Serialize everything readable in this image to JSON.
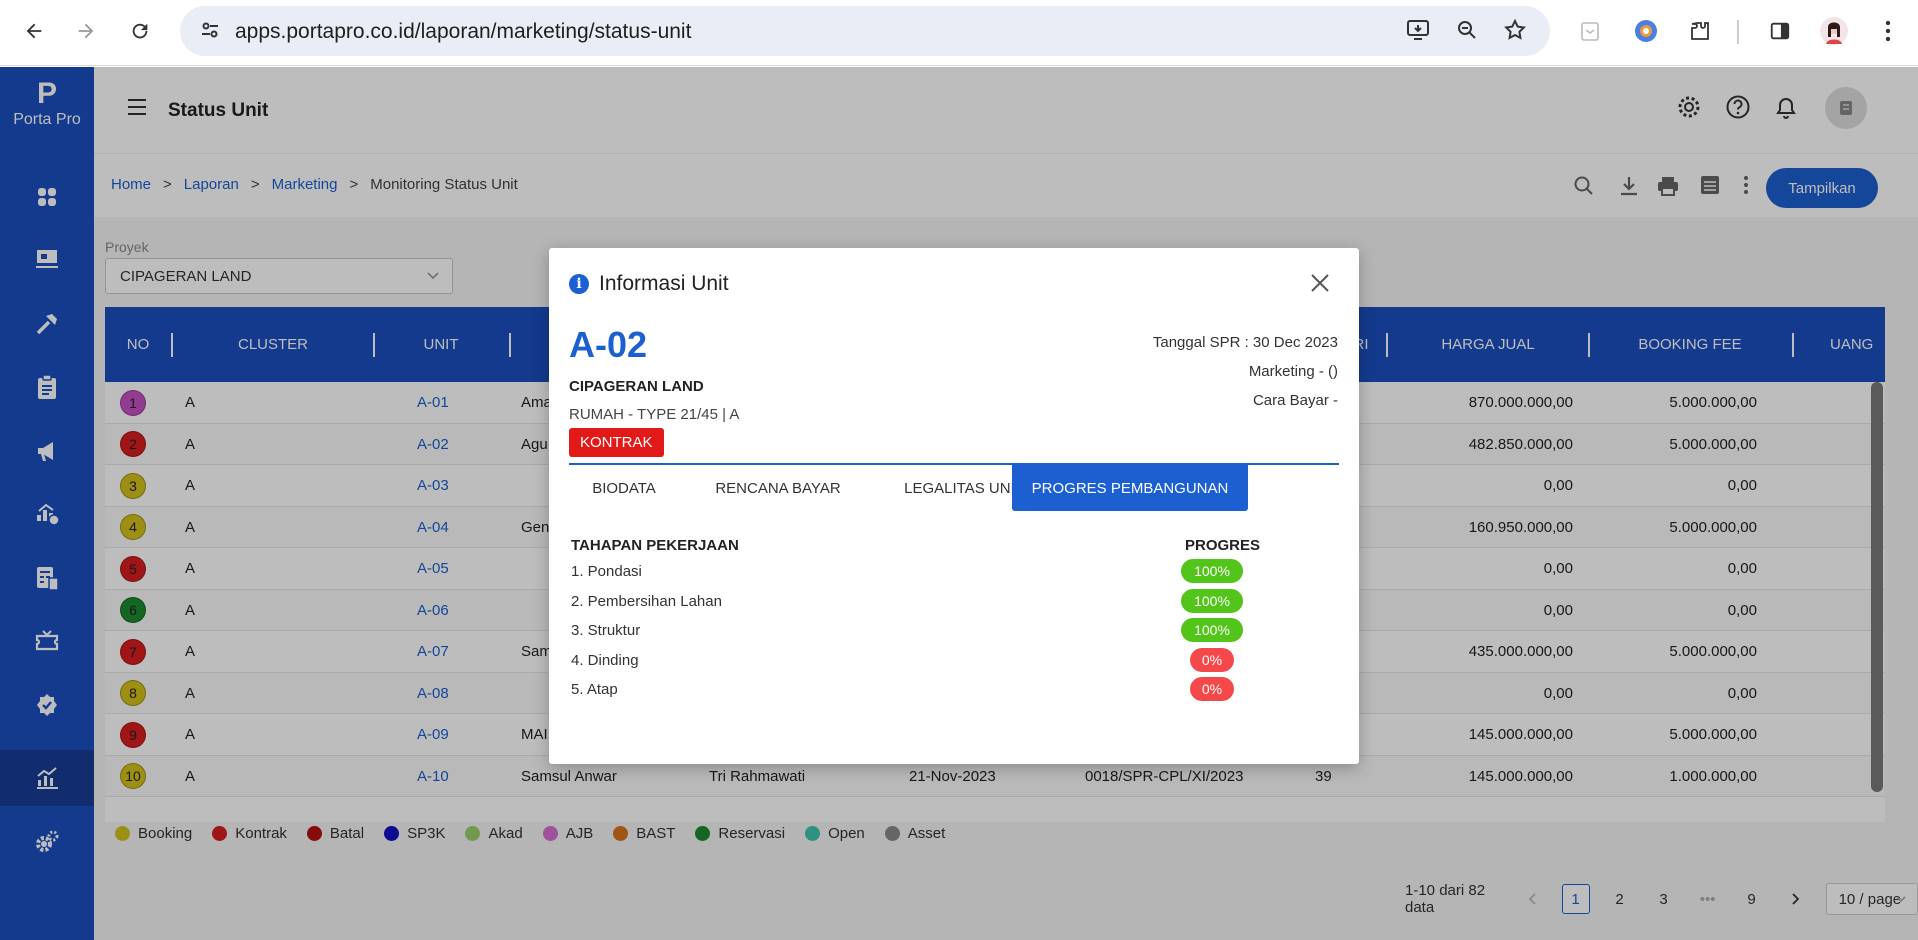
{
  "browser": {
    "url": "apps.portapro.co.id/laporan/marketing/status-unit"
  },
  "app": {
    "logo_mark": "P",
    "logo_text": "Porta Pro",
    "page_title": "Status Unit",
    "breadcrumb": [
      "Home",
      "Laporan",
      "Marketing",
      "Monitoring Status Unit"
    ],
    "breadcrumb_sep": ">",
    "show_button": "Tampilkan",
    "filter_label": "Proyek",
    "filter_value": "CIPAGERAN LAND"
  },
  "table": {
    "headers": [
      "NO",
      "CLUSTER",
      "UNIT",
      "HARGA JUAL",
      "BOOKING FEE",
      "UANG"
    ],
    "hidden_header_fragment": "RI",
    "rows": [
      {
        "no": "1",
        "color": "#c452c4",
        "cluster": "A",
        "unit": "A-01",
        "name": "Ama",
        "harga": "870.000.000,00",
        "booking": "5.000.000,00"
      },
      {
        "no": "2",
        "color": "#d81e1e",
        "cluster": "A",
        "unit": "A-02",
        "name": "Agu",
        "harga": "482.850.000,00",
        "booking": "5.000.000,00"
      },
      {
        "no": "3",
        "color": "#d4c21a",
        "cluster": "A",
        "unit": "A-03",
        "name": "",
        "harga": "0,00",
        "booking": "0,00"
      },
      {
        "no": "4",
        "color": "#d4c21a",
        "cluster": "A",
        "unit": "A-04",
        "name": "Gen",
        "harga": "160.950.000,00",
        "booking": "5.000.000,00"
      },
      {
        "no": "5",
        "color": "#d81e1e",
        "cluster": "A",
        "unit": "A-05",
        "name": "",
        "harga": "0,00",
        "booking": "0,00"
      },
      {
        "no": "6",
        "color": "#1c8a2e",
        "cluster": "A",
        "unit": "A-06",
        "name": "",
        "harga": "0,00",
        "booking": "0,00"
      },
      {
        "no": "7",
        "color": "#d81e1e",
        "cluster": "A",
        "unit": "A-07",
        "name": "Sam",
        "harga": "435.000.000,00",
        "booking": "5.000.000,00"
      },
      {
        "no": "8",
        "color": "#d4c21a",
        "cluster": "A",
        "unit": "A-08",
        "name": "",
        "harga": "0,00",
        "booking": "0,00"
      },
      {
        "no": "9",
        "color": "#d81e1e",
        "cluster": "A",
        "unit": "A-09",
        "name": "MAI",
        "harga": "145.000.000,00",
        "booking": "5.000.000,00"
      },
      {
        "no": "10",
        "color": "#d4c21a",
        "cluster": "A",
        "unit": "A-10",
        "name": "Samsul Anwar",
        "marketing": "Tri Rahmawati",
        "date": "21-Nov-2023",
        "spr": "0018/SPR-CPL/XI/2023",
        "extra": "39",
        "harga": "145.000.000,00",
        "booking": "1.000.000,00"
      }
    ]
  },
  "legend": [
    {
      "label": "Booking",
      "color": "#d4c21a"
    },
    {
      "label": "Kontrak",
      "color": "#d81e1e"
    },
    {
      "label": "Batal",
      "color": "#b50f0f"
    },
    {
      "label": "SP3K",
      "color": "#1212c8"
    },
    {
      "label": "Akad",
      "color": "#9ccf6e"
    },
    {
      "label": "AJB",
      "color": "#d66fd6"
    },
    {
      "label": "BAST",
      "color": "#d8731b"
    },
    {
      "label": "Reservasi",
      "color": "#1c8a2e"
    },
    {
      "label": "Open",
      "color": "#3fc6b0"
    },
    {
      "label": "Asset",
      "color": "#8a8a8a"
    }
  ],
  "pagination": {
    "summary": "1-10 dari 82 data",
    "pages": [
      "1",
      "2",
      "3",
      "•••",
      "9"
    ],
    "current": "1",
    "page_size": "10 / page"
  },
  "modal": {
    "title": "Informasi Unit",
    "unit_code": "A-02",
    "project": "CIPAGERAN LAND",
    "type": "RUMAH - TYPE 21/45 | A",
    "status_badge": "KONTRAK",
    "status_color": "#e11919",
    "spr_date": "Tanggal SPR : 30 Dec 2023",
    "marketing": "Marketing - ()",
    "payment": "Cara Bayar -",
    "tabs": [
      "BIODATA",
      "RENCANA BAYAR",
      "LEGALITAS UNIT",
      "PROGRES PEMBANGUNAN"
    ],
    "active_tab": "PROGRES PEMBANGUNAN",
    "col_stage": "TAHAPAN PEKERJAAN",
    "col_progress": "PROGRES",
    "stages": [
      {
        "label": "1. Pondasi",
        "progress": "100%",
        "color": "#52c41a"
      },
      {
        "label": "2. Pembersihan Lahan",
        "progress": "100%",
        "color": "#52c41a"
      },
      {
        "label": "3. Struktur",
        "progress": "100%",
        "color": "#52c41a"
      },
      {
        "label": "4. Dinding",
        "progress": "0%",
        "color": "#f5484b"
      },
      {
        "label": "5. Atap",
        "progress": "0%",
        "color": "#f5484b"
      }
    ]
  }
}
